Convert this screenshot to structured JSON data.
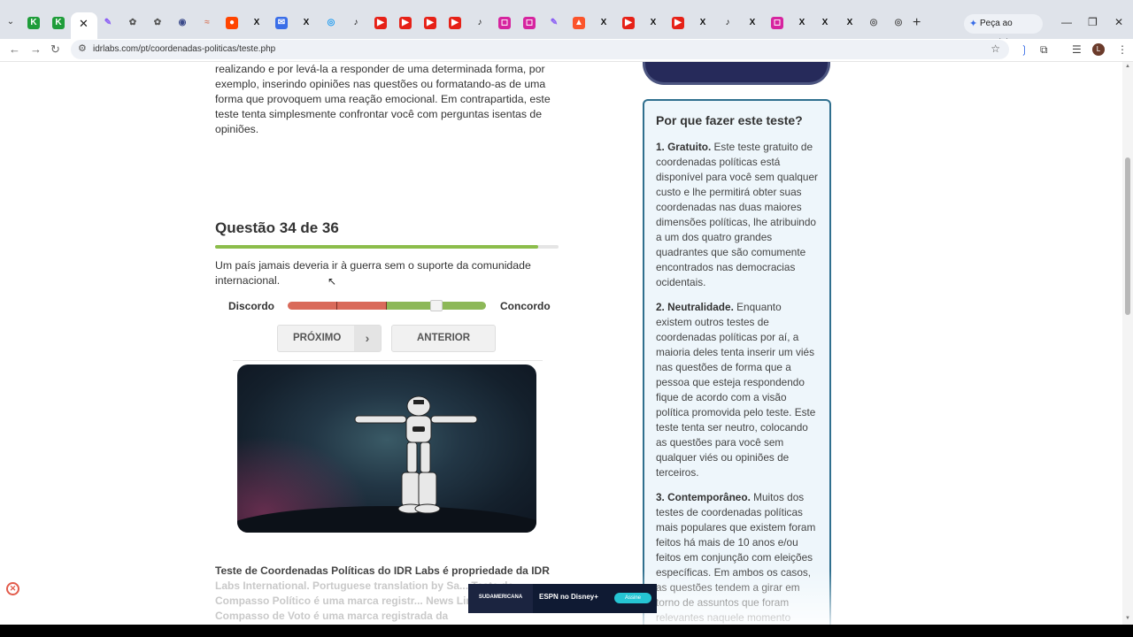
{
  "browser": {
    "tabs": [
      {
        "icon": "kiwi-icon",
        "color": "#1f9d3a"
      },
      {
        "icon": "kiwi-icon",
        "color": "#1f9d3a"
      },
      {
        "icon": "pen-icon",
        "color": "#8a5cf5"
      },
      {
        "icon": "openai-icon",
        "color": "#555555"
      },
      {
        "icon": "openai-icon",
        "color": "#555555"
      },
      {
        "icon": "circle-icon",
        "color": "#3b4a8a"
      },
      {
        "icon": "wave-icon",
        "color": "#d9826a"
      },
      {
        "icon": "reddit-icon",
        "color": "#ff4500"
      },
      {
        "icon": "x-icon",
        "color": "#111111"
      },
      {
        "icon": "mail-icon",
        "color": "#3a6ee8"
      },
      {
        "icon": "x-icon",
        "color": "#111111"
      },
      {
        "icon": "globe-icon",
        "color": "#1d9bf0"
      },
      {
        "icon": "tiktok-icon",
        "color": "#111111"
      },
      {
        "icon": "youtube-icon",
        "color": "#e62117"
      },
      {
        "icon": "youtube-icon",
        "color": "#e62117"
      },
      {
        "icon": "youtube-icon",
        "color": "#e62117"
      },
      {
        "icon": "youtube-icon",
        "color": "#e62117"
      },
      {
        "icon": "tiktok-icon",
        "color": "#111111"
      },
      {
        "icon": "instagram-icon",
        "color": "#d6249f"
      },
      {
        "icon": "instagram-icon",
        "color": "#d6249f"
      },
      {
        "icon": "pen-icon",
        "color": "#8a5cf5"
      },
      {
        "icon": "brave-icon",
        "color": "#fb542b"
      },
      {
        "icon": "x-icon",
        "color": "#111111"
      },
      {
        "icon": "youtube-icon",
        "color": "#e62117"
      },
      {
        "icon": "x-icon",
        "color": "#111111"
      },
      {
        "icon": "youtube-icon",
        "color": "#e62117"
      },
      {
        "icon": "x-icon",
        "color": "#111111"
      },
      {
        "icon": "tiktok-icon",
        "color": "#111111"
      },
      {
        "icon": "x-icon",
        "color": "#111111"
      },
      {
        "icon": "instagram-icon",
        "color": "#d6249f"
      },
      {
        "icon": "x-icon",
        "color": "#111111"
      },
      {
        "icon": "x-icon",
        "color": "#111111"
      },
      {
        "icon": "x-icon",
        "color": "#111111"
      },
      {
        "icon": "chrome-icon",
        "color": "#555555"
      },
      {
        "icon": "chrome-icon",
        "color": "#555555"
      }
    ],
    "gemini_label": "Peça ao Gemini",
    "url": "idrlabs.com/pt/coordenadas-politicas/teste.php",
    "avatar_letter": "L"
  },
  "main": {
    "intro_text": "realizando e por levá-la a responder de uma determinada forma, por exemplo, inserindo opiniões nas questões ou formatando-as de uma forma que provoquem uma reação emocional. Em contrapartida, este teste tenta simplesmente confrontar você com perguntas isentas de opiniões.",
    "question_title": "Questão 34 de 36",
    "progress": 0.94,
    "question_text": "Um país jamais deveria ir à guerra sem o suporte da comunidade internacional.",
    "scale_left": "Discordo",
    "scale_right": "Concordo",
    "slider_value": 0.75,
    "next_label": "PRÓXIMO",
    "prev_label": "ANTERIOR",
    "copyright_visible": "Teste de Coordenadas Políticas do IDR Labs é propriedade da IDR",
    "copyright_faded": "Labs International. Portuguese translation by Sa... Teste de Compasso Político é uma marca registr... News Limited. O Compasso de Voto é uma marca registrada da"
  },
  "sidebar": {
    "title": "Por que fazer este teste?",
    "items": [
      {
        "heading": "1. Gratuito.",
        "text": " Este teste gratuito de coordenadas políticas está disponível para você sem qualquer custo e lhe permitirá obter suas coordenadas nas duas maiores dimensões políticas, lhe atribuindo a um dos quatro grandes quadrantes que são comumente encontrados nas democracias ocidentais."
      },
      {
        "heading": "2. Neutralidade.",
        "text": " Enquanto existem outros testes de coordenadas políticas por aí, a maioria deles tenta inserir um viés nas questões de forma que a pessoa que esteja respondendo fique de acordo com a visão política promovida pelo teste. Este teste tenta ser neutro, colocando as questões para você sem qualquer viés ou opiniões de terceiros."
      },
      {
        "heading": "3. Contemporâneo.",
        "text": " Muitos dos testes de coordenadas políticas mais populares que existem foram feitos há mais de 10 anos e/ou feitos em conjunção com eleições específicas. Em ambos os casos, as questões tendem a girar em torno de assuntos que foram relevantes naquele momento"
      }
    ]
  },
  "ad": {
    "left_text": "SUDAMERICANA",
    "right_text": "ESPN no Disney+",
    "cta": "Assine"
  }
}
